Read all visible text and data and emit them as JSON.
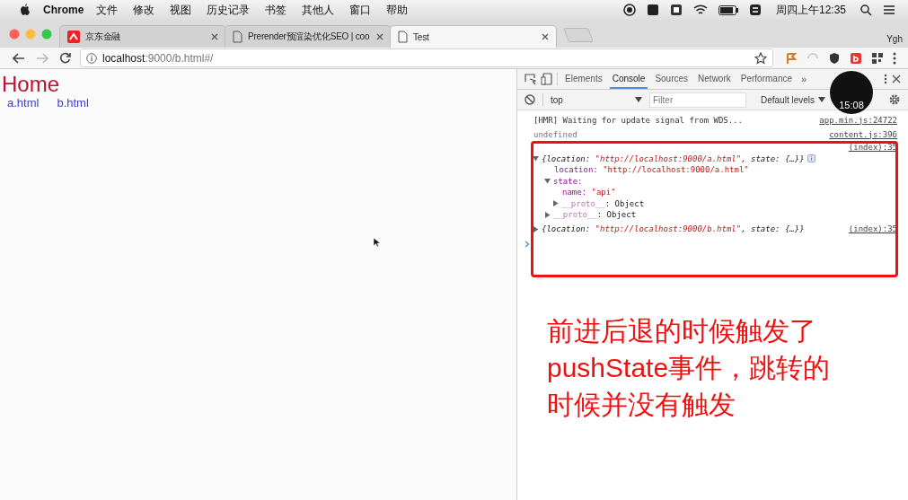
{
  "menu_bar": {
    "app": "Chrome",
    "items": [
      "文件",
      "修改",
      "视图",
      "历史记录",
      "书签",
      "其他人",
      "窗口",
      "帮助"
    ],
    "clock": "周四上午12:35"
  },
  "tabs": [
    {
      "title": "京东金融",
      "kind": "brand",
      "selected": false
    },
    {
      "title": "Prerender预渲染优化SEO | coo",
      "kind": "page",
      "selected": false
    },
    {
      "title": "Test",
      "kind": "page",
      "selected": true
    }
  ],
  "profile": "Ygh",
  "address_bar": {
    "url_host": "localhost",
    "url_rest": ":9000/b.html#/",
    "forward_disabled": true
  },
  "page": {
    "heading": "Home",
    "links": [
      "a.html",
      "b.html"
    ]
  },
  "devtools": {
    "tabs": [
      {
        "label": "Elements",
        "selected": false
      },
      {
        "label": "Console",
        "selected": true
      },
      {
        "label": "Sources",
        "selected": false
      },
      {
        "label": "Network",
        "selected": false
      },
      {
        "label": "Performance",
        "selected": false
      }
    ],
    "more_tabs": "»",
    "context": "top",
    "filter_placeholder": "Filter",
    "levels": "Default levels",
    "messages": [
      {
        "kind": "log",
        "text": "[HMR] Waiting for update signal from WDS...",
        "source": "app.min.js:24722"
      },
      {
        "kind": "result",
        "text": "undefined",
        "source": "content.js:396"
      },
      {
        "kind": "object",
        "source": "(index):35",
        "expanded": true,
        "summary": [
          {
            "t": "{location: "
          },
          {
            "t": "\"http://localhost:9000/a.html\"",
            "kind": "string"
          },
          {
            "t": ", state: {…}}"
          }
        ],
        "children": [
          {
            "kind": "prop",
            "key": "location:",
            "value": "\"http://localhost:9000/a.html\""
          },
          {
            "kind": "object",
            "key": "state:",
            "expanded": true,
            "children": [
              {
                "kind": "prop",
                "key": "name:",
                "value": "\"api\""
              },
              {
                "kind": "object",
                "key": "__proto__",
                "value": ": Object",
                "expanded": false
              }
            ]
          },
          {
            "kind": "object",
            "key": "__proto__",
            "value": ": Object",
            "expanded": false
          }
        ]
      },
      {
        "kind": "object",
        "source": "(index):35",
        "expanded": false,
        "summary": [
          {
            "t": "{location: "
          },
          {
            "t": "\"http://localhost:9000/b.html\"",
            "kind": "string"
          },
          {
            "t": ", state: {…}}"
          }
        ]
      }
    ],
    "timer": "15:08"
  },
  "annotation": {
    "lines": [
      "前进后退的时候触发了",
      "pushState事件，跳转的",
      "时候并没有触发"
    ]
  }
}
